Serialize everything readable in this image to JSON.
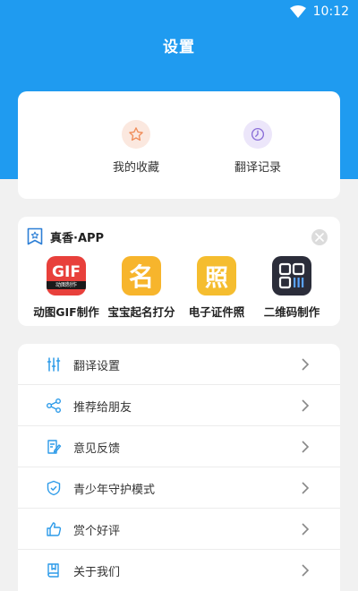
{
  "status": {
    "time": "10:12"
  },
  "header": {
    "title": "设置"
  },
  "quick": [
    {
      "label": "我的收藏",
      "icon": "star-icon",
      "color": "#f08d5a",
      "bg": "#fbe8df"
    },
    {
      "label": "翻译记录",
      "icon": "clock-icon",
      "color": "#8b6fd8",
      "bg": "#ece6fa"
    }
  ],
  "apps": {
    "title": "真香·APP",
    "items": [
      {
        "label": "动图GIF制作",
        "icon": "gif-app-icon",
        "badge": "GIF",
        "sub": "动图制作",
        "color": "#e8403b"
      },
      {
        "label": "宝宝起名打分",
        "icon": "baby-name-app-icon",
        "glyph": "名",
        "color": "#f7b52c"
      },
      {
        "label": "电子证件照",
        "icon": "id-photo-app-icon",
        "glyph": "照",
        "color": "#f5bd2f"
      },
      {
        "label": "二维码制作",
        "icon": "qrcode-app-icon",
        "color": "#2b2d3a"
      }
    ]
  },
  "menu": [
    {
      "label": "翻译设置",
      "icon": "sliders-icon"
    },
    {
      "label": "推荐给朋友",
      "icon": "share-icon"
    },
    {
      "label": "意见反馈",
      "icon": "feedback-icon"
    },
    {
      "label": "青少年守护模式",
      "icon": "shield-icon"
    },
    {
      "label": "赏个好评",
      "icon": "thumbs-up-icon"
    },
    {
      "label": "关于我们",
      "icon": "info-book-icon"
    }
  ],
  "colors": {
    "primary": "#1f9bf0",
    "menu_icon": "#2d9be9"
  }
}
